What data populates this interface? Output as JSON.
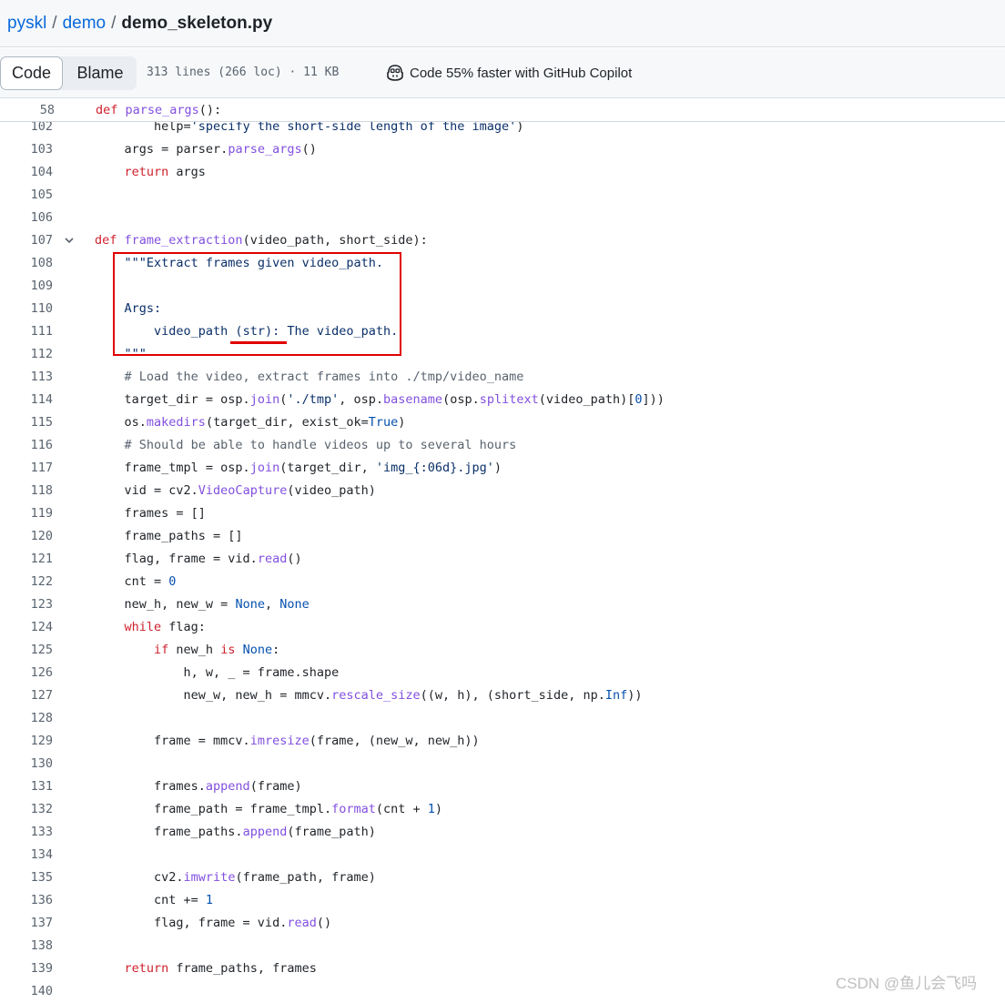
{
  "breadcrumb": {
    "repo": "pyskl",
    "folder": "demo",
    "file": "demo_skeleton.py",
    "separator": "/"
  },
  "toolbar": {
    "code_tab": "Code",
    "blame_tab": "Blame",
    "file_info": "313 lines (266 loc) · 11 KB",
    "copilot_text": "Code 55% faster with GitHub Copilot",
    "copilot_icon": "copilot-icon"
  },
  "sticky_header": {
    "line_number": "58",
    "code": [
      {
        "t": "def ",
        "c": "k"
      },
      {
        "t": "parse_args",
        "c": "f"
      },
      {
        "t": "():",
        "c": ""
      }
    ]
  },
  "code_lines": [
    {
      "num": "102",
      "tokens": [
        {
          "t": "        help=",
          "c": ""
        },
        {
          "t": "'specify the short-side length of the image'",
          "c": "s"
        },
        {
          "t": ")",
          "c": ""
        }
      ]
    },
    {
      "num": "103",
      "tokens": [
        {
          "t": "    args = parser.",
          "c": ""
        },
        {
          "t": "parse_args",
          "c": "f"
        },
        {
          "t": "()",
          "c": ""
        }
      ]
    },
    {
      "num": "104",
      "tokens": [
        {
          "t": "    ",
          "c": ""
        },
        {
          "t": "return",
          "c": "k"
        },
        {
          "t": " args",
          "c": ""
        }
      ]
    },
    {
      "num": "105",
      "tokens": []
    },
    {
      "num": "106",
      "tokens": []
    },
    {
      "num": "107",
      "fold": true,
      "tokens": [
        {
          "t": "def ",
          "c": "k"
        },
        {
          "t": "frame_extraction",
          "c": "f"
        },
        {
          "t": "(video_path, short_side):",
          "c": ""
        }
      ]
    },
    {
      "num": "108",
      "tokens": [
        {
          "t": "    ",
          "c": ""
        },
        {
          "t": "\"\"\"Extract frames given video_path.",
          "c": "s"
        }
      ]
    },
    {
      "num": "109",
      "tokens": []
    },
    {
      "num": "110",
      "tokens": [
        {
          "t": "    ",
          "c": ""
        },
        {
          "t": "Args:",
          "c": "s"
        }
      ]
    },
    {
      "num": "111",
      "tokens": [
        {
          "t": "        ",
          "c": ""
        },
        {
          "t": "video_path (str): The video_path.",
          "c": "s"
        }
      ]
    },
    {
      "num": "112",
      "tokens": [
        {
          "t": "    ",
          "c": ""
        },
        {
          "t": "\"\"\"",
          "c": "s"
        }
      ]
    },
    {
      "num": "113",
      "tokens": [
        {
          "t": "    ",
          "c": ""
        },
        {
          "t": "# Load the video, extract frames into ./tmp/video_name",
          "c": "c"
        }
      ]
    },
    {
      "num": "114",
      "tokens": [
        {
          "t": "    target_dir = osp.",
          "c": ""
        },
        {
          "t": "join",
          "c": "f"
        },
        {
          "t": "(",
          "c": ""
        },
        {
          "t": "'./tmp'",
          "c": "s"
        },
        {
          "t": ", osp.",
          "c": ""
        },
        {
          "t": "basename",
          "c": "f"
        },
        {
          "t": "(osp.",
          "c": ""
        },
        {
          "t": "splitext",
          "c": "f"
        },
        {
          "t": "(video_path)[",
          "c": ""
        },
        {
          "t": "0",
          "c": "n"
        },
        {
          "t": "]))",
          "c": ""
        }
      ]
    },
    {
      "num": "115",
      "tokens": [
        {
          "t": "    os.",
          "c": ""
        },
        {
          "t": "makedirs",
          "c": "f"
        },
        {
          "t": "(target_dir, exist_ok=",
          "c": ""
        },
        {
          "t": "True",
          "c": "n"
        },
        {
          "t": ")",
          "c": ""
        }
      ]
    },
    {
      "num": "116",
      "tokens": [
        {
          "t": "    ",
          "c": ""
        },
        {
          "t": "# Should be able to handle videos up to several hours",
          "c": "c"
        }
      ]
    },
    {
      "num": "117",
      "tokens": [
        {
          "t": "    frame_tmpl = osp.",
          "c": ""
        },
        {
          "t": "join",
          "c": "f"
        },
        {
          "t": "(target_dir, ",
          "c": ""
        },
        {
          "t": "'img_{:06d}.jpg'",
          "c": "s"
        },
        {
          "t": ")",
          "c": ""
        }
      ]
    },
    {
      "num": "118",
      "tokens": [
        {
          "t": "    vid = cv2.",
          "c": ""
        },
        {
          "t": "VideoCapture",
          "c": "f"
        },
        {
          "t": "(video_path)",
          "c": ""
        }
      ]
    },
    {
      "num": "119",
      "tokens": [
        {
          "t": "    frames = []",
          "c": ""
        }
      ]
    },
    {
      "num": "120",
      "tokens": [
        {
          "t": "    frame_paths = []",
          "c": ""
        }
      ]
    },
    {
      "num": "121",
      "tokens": [
        {
          "t": "    flag, frame = vid.",
          "c": ""
        },
        {
          "t": "read",
          "c": "f"
        },
        {
          "t": "()",
          "c": ""
        }
      ]
    },
    {
      "num": "122",
      "tokens": [
        {
          "t": "    cnt = ",
          "c": ""
        },
        {
          "t": "0",
          "c": "n"
        }
      ]
    },
    {
      "num": "123",
      "tokens": [
        {
          "t": "    new_h, new_w = ",
          "c": ""
        },
        {
          "t": "None",
          "c": "n"
        },
        {
          "t": ", ",
          "c": ""
        },
        {
          "t": "None",
          "c": "n"
        }
      ]
    },
    {
      "num": "124",
      "tokens": [
        {
          "t": "    ",
          "c": ""
        },
        {
          "t": "while",
          "c": "k"
        },
        {
          "t": " flag:",
          "c": ""
        }
      ]
    },
    {
      "num": "125",
      "tokens": [
        {
          "t": "        ",
          "c": ""
        },
        {
          "t": "if",
          "c": "k"
        },
        {
          "t": " new_h ",
          "c": ""
        },
        {
          "t": "is",
          "c": "k"
        },
        {
          "t": " ",
          "c": ""
        },
        {
          "t": "None",
          "c": "n"
        },
        {
          "t": ":",
          "c": ""
        }
      ]
    },
    {
      "num": "126",
      "tokens": [
        {
          "t": "            h, w, _ = frame.shape",
          "c": ""
        }
      ]
    },
    {
      "num": "127",
      "tokens": [
        {
          "t": "            new_w, new_h = mmcv.",
          "c": ""
        },
        {
          "t": "rescale_size",
          "c": "f"
        },
        {
          "t": "((w, h), (short_side, np.",
          "c": ""
        },
        {
          "t": "Inf",
          "c": "n"
        },
        {
          "t": "))",
          "c": ""
        }
      ]
    },
    {
      "num": "128",
      "tokens": []
    },
    {
      "num": "129",
      "tokens": [
        {
          "t": "        frame = mmcv.",
          "c": ""
        },
        {
          "t": "imresize",
          "c": "f"
        },
        {
          "t": "(frame, (new_w, new_h))",
          "c": ""
        }
      ]
    },
    {
      "num": "130",
      "tokens": []
    },
    {
      "num": "131",
      "tokens": [
        {
          "t": "        frames.",
          "c": ""
        },
        {
          "t": "append",
          "c": "f"
        },
        {
          "t": "(frame)",
          "c": ""
        }
      ]
    },
    {
      "num": "132",
      "tokens": [
        {
          "t": "        frame_path = frame_tmpl.",
          "c": ""
        },
        {
          "t": "format",
          "c": "f"
        },
        {
          "t": "(cnt + ",
          "c": ""
        },
        {
          "t": "1",
          "c": "n"
        },
        {
          "t": ")",
          "c": ""
        }
      ]
    },
    {
      "num": "133",
      "tokens": [
        {
          "t": "        frame_paths.",
          "c": ""
        },
        {
          "t": "append",
          "c": "f"
        },
        {
          "t": "(frame_path)",
          "c": ""
        }
      ]
    },
    {
      "num": "134",
      "tokens": []
    },
    {
      "num": "135",
      "tokens": [
        {
          "t": "        cv2.",
          "c": ""
        },
        {
          "t": "imwrite",
          "c": "f"
        },
        {
          "t": "(frame_path, frame)",
          "c": ""
        }
      ]
    },
    {
      "num": "136",
      "tokens": [
        {
          "t": "        cnt += ",
          "c": ""
        },
        {
          "t": "1",
          "c": "n"
        }
      ]
    },
    {
      "num": "137",
      "tokens": [
        {
          "t": "        flag, frame = vid.",
          "c": ""
        },
        {
          "t": "read",
          "c": "f"
        },
        {
          "t": "()",
          "c": ""
        }
      ]
    },
    {
      "num": "138",
      "tokens": []
    },
    {
      "num": "139",
      "tokens": [
        {
          "t": "    ",
          "c": ""
        },
        {
          "t": "return",
          "c": "k"
        },
        {
          "t": " frame_paths, frames",
          "c": ""
        }
      ]
    },
    {
      "num": "140",
      "tokens": []
    }
  ],
  "annotations": {
    "box_color": "#e00000"
  },
  "watermark": "CSDN @鱼儿会飞吗"
}
